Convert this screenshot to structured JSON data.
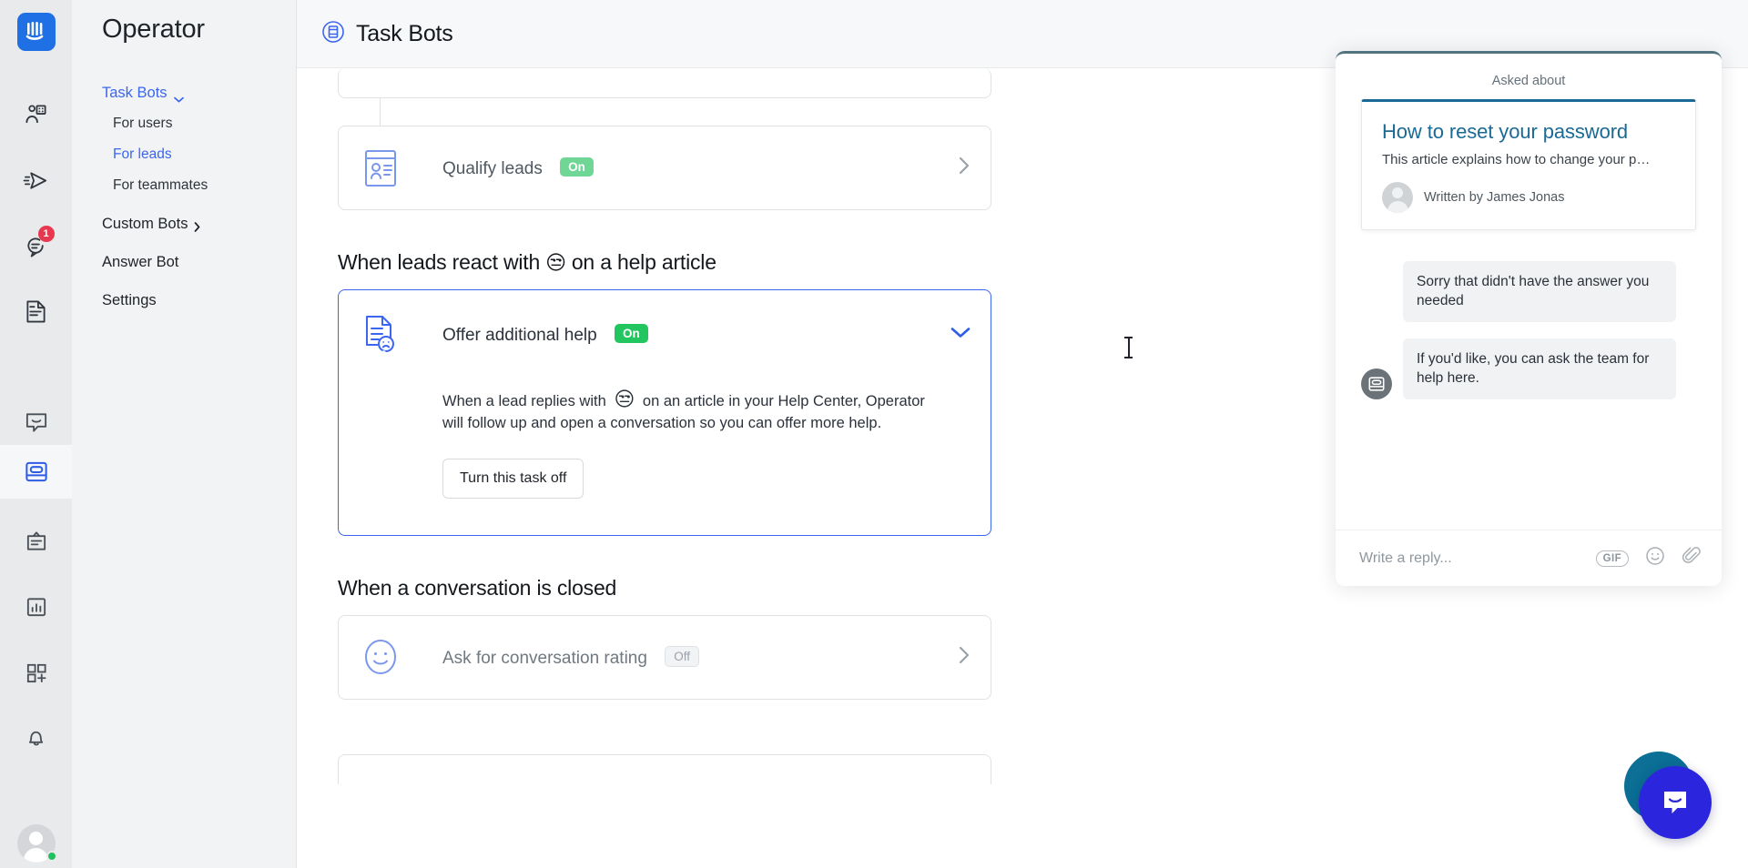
{
  "rail": {
    "logo_icon": "intercom-logo-icon",
    "items": [
      {
        "icon": "contacts-icon",
        "badge": null
      },
      {
        "icon": "outbound-send-icon",
        "badge": null
      },
      {
        "icon": "inbox-conversations-icon",
        "badge": "1"
      },
      {
        "icon": "articles-icon",
        "badge": null
      },
      {
        "icon": "messenger-icon",
        "badge": null
      },
      {
        "icon": "operator-bot-icon",
        "badge": null,
        "active": true
      },
      {
        "icon": "clipboard-icon",
        "badge": null
      },
      {
        "icon": "reports-chart-icon",
        "badge": null
      },
      {
        "icon": "apps-grid-add-icon",
        "badge": null
      },
      {
        "icon": "bell-icon",
        "badge": null
      }
    ],
    "avatar_status": "online"
  },
  "nav": {
    "title": "Operator",
    "items": [
      {
        "label": "Task Bots",
        "type": "group",
        "state": "active",
        "chevron": "chevron-down-icon"
      },
      {
        "label": "For users",
        "type": "sub",
        "state": "normal"
      },
      {
        "label": "For leads",
        "type": "sub",
        "state": "active"
      },
      {
        "label": "For teammates",
        "type": "sub",
        "state": "normal"
      },
      {
        "label": "Custom Bots",
        "type": "group",
        "state": "normal",
        "chevron": "chevron-right-icon"
      },
      {
        "label": "Answer Bot",
        "type": "group",
        "state": "normal",
        "chevron": null
      },
      {
        "label": "Settings",
        "type": "group",
        "state": "normal",
        "chevron": null
      }
    ]
  },
  "topbar": {
    "icon": "task-bots-icon",
    "title": "Task Bots"
  },
  "main": {
    "qualify_card": {
      "icon": "qualify-leads-icon",
      "title": "Qualify leads",
      "status": "On",
      "arrow": "chevron-right-icon"
    },
    "section_react": {
      "heading_before": "When leads react with",
      "heading_emoji": "😒",
      "heading_after": "on a help article"
    },
    "expanded_card": {
      "icon": "offer-additional-help-icon",
      "title": "Offer additional help",
      "status": "On",
      "chevron": "chevron-down-icon",
      "description_part1": "When a lead replies with",
      "description_emoji": "😒",
      "description_part2": "on an article in your Help Center, Operator will follow up and open a conversation so you can offer more help.",
      "button_label": "Turn this task off"
    },
    "section_closed": {
      "heading": "When a conversation is closed",
      "card": {
        "icon": "smiley-rating-icon",
        "title": "Ask for conversation rating",
        "status": "Off",
        "arrow": "chevron-right-icon"
      }
    }
  },
  "chat_preview": {
    "asked_about_label": "Asked about",
    "article": {
      "title": "How to reset your password",
      "description": "This article explains how to change your p…",
      "author_prefix": "Written by James Jonas",
      "avatar": "author-avatar"
    },
    "messages": [
      {
        "text": "Sorry that didn't have the answer you needed",
        "has_avatar": false
      },
      {
        "text": "If you'd like, you can ask the team for help here.",
        "has_avatar": true,
        "avatar_icon": "operator-bot-icon"
      }
    ],
    "composer": {
      "placeholder": "Write a reply...",
      "icons": [
        {
          "name": "gif-icon",
          "label": "GIF"
        },
        {
          "name": "emoji-smiley-icon",
          "label": ""
        },
        {
          "name": "attachment-paperclip-icon",
          "label": ""
        }
      ]
    }
  },
  "fab": {
    "icon": "messenger-launcher-icon",
    "color": "#2b26dd",
    "back_color": "#0b6f96"
  }
}
